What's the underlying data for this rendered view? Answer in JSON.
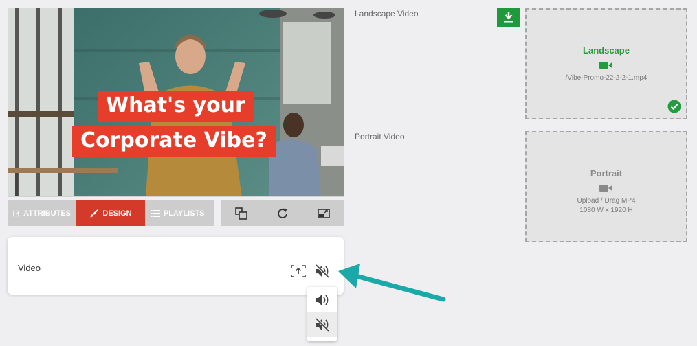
{
  "preview": {
    "headline_line1": "What's your",
    "headline_line2": "Corporate Vibe?"
  },
  "toolbar": {
    "tabs": [
      {
        "label": "ATTRIBUTES",
        "icon": "edit-icon",
        "active": false
      },
      {
        "label": "DESIGN",
        "icon": "brush-icon",
        "active": true
      },
      {
        "label": "PLAYLISTS",
        "icon": "list-icon",
        "active": false
      }
    ],
    "tools": [
      "layers-icon",
      "refresh-icon",
      "fit-screen-icon"
    ]
  },
  "video_card": {
    "label": "Video",
    "buttons": [
      "upload-frame-icon",
      "mute-icon"
    ],
    "audio_menu": [
      "volume-on-icon",
      "volume-off-icon"
    ]
  },
  "landscape": {
    "section_label": "Landscape Video",
    "box_title": "Landscape",
    "file": "/Vibe-Promo-22-2-2-1.mp4",
    "status": "check-circle-icon"
  },
  "portrait": {
    "section_label": "Portrait Video",
    "box_title": "Portrait",
    "hint_line1": "Upload / Drag MP4",
    "hint_line2": "1080 W x 1920 H"
  },
  "colors": {
    "accent_red": "#d33a2a",
    "accent_green": "#1e9a3c",
    "arrow_teal": "#1aa8a8"
  }
}
